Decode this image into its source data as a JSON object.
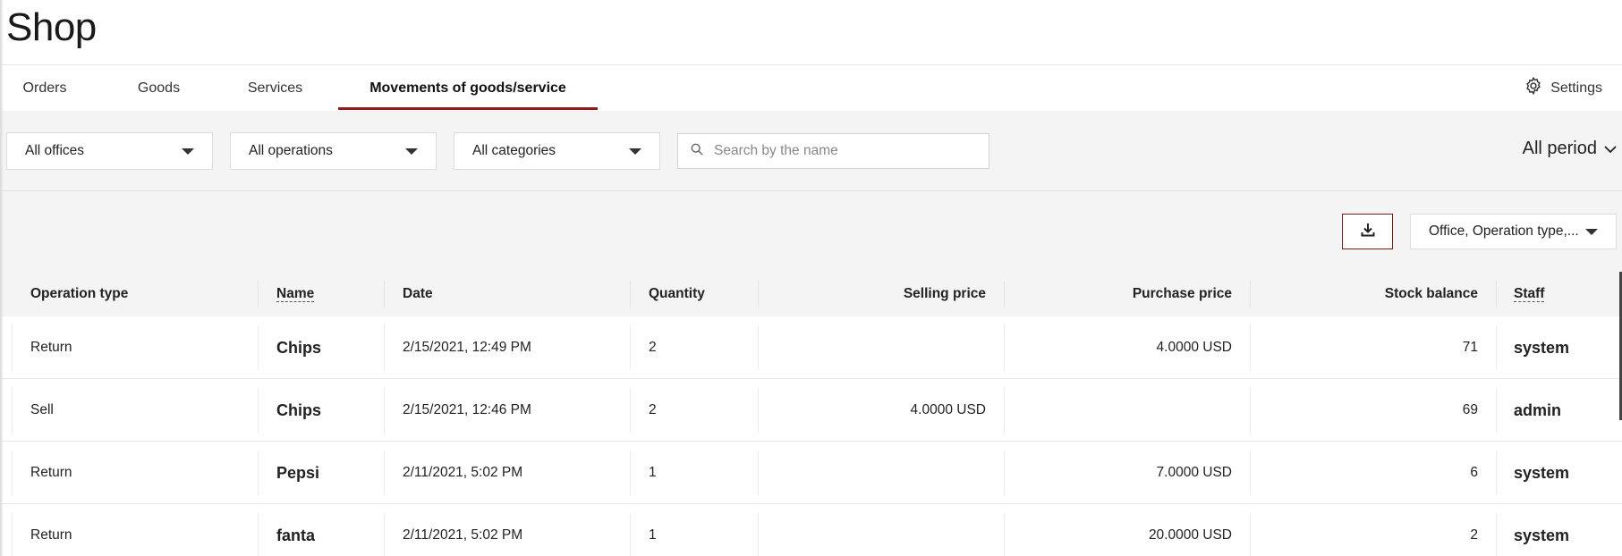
{
  "page": {
    "title": "Shop"
  },
  "tabs": [
    {
      "label": "Orders"
    },
    {
      "label": "Goods"
    },
    {
      "label": "Services"
    },
    {
      "label": "Movements of goods/service",
      "active": true
    }
  ],
  "settings": {
    "label": "Settings",
    "icon": "gear-icon"
  },
  "filters": {
    "offices": "All offices",
    "operations": "All operations",
    "categories": "All categories",
    "search_placeholder": "Search by the name",
    "period": "All period"
  },
  "toolbar": {
    "download_icon": "download-icon",
    "columns_select": "Office, Operation type,..."
  },
  "table": {
    "headers": {
      "operation_type": "Operation type",
      "name": "Name",
      "date": "Date",
      "quantity": "Quantity",
      "selling_price": "Selling price",
      "purchase_price": "Purchase price",
      "stock_balance": "Stock balance",
      "staff": "Staff"
    },
    "rows": [
      {
        "operation_type": "Return",
        "name": "Chips",
        "date": "2/15/2021, 12:49 PM",
        "quantity": "2",
        "selling_price": "",
        "purchase_price": "4.0000 USD",
        "stock_balance": "71",
        "staff": "system"
      },
      {
        "operation_type": "Sell",
        "name": "Chips",
        "date": "2/15/2021, 12:46 PM",
        "quantity": "2",
        "selling_price": "4.0000 USD",
        "purchase_price": "",
        "stock_balance": "69",
        "staff": "admin"
      },
      {
        "operation_type": "Return",
        "name": "Pepsi",
        "date": "2/11/2021, 5:02 PM",
        "quantity": "1",
        "selling_price": "",
        "purchase_price": "7.0000 USD",
        "stock_balance": "6",
        "staff": "system"
      },
      {
        "operation_type": "Return",
        "name": "fanta",
        "date": "2/11/2021, 5:02 PM",
        "quantity": "1",
        "selling_price": "",
        "purchase_price": "20.0000 USD",
        "stock_balance": "2",
        "staff": "system"
      }
    ]
  },
  "colors": {
    "accent": "#8e1a1a",
    "background": "#f4f4f4"
  }
}
